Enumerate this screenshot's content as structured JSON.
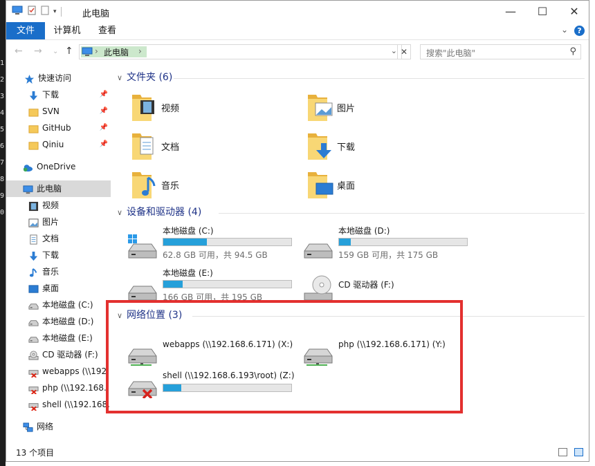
{
  "window": {
    "title": "此电脑",
    "min_glyph": "—",
    "max_glyph": "☐",
    "close_glyph": "✕"
  },
  "ribbon": {
    "tabs": [
      {
        "label": "文件"
      },
      {
        "label": "计算机"
      },
      {
        "label": "查看"
      }
    ],
    "help": "?"
  },
  "nav": {
    "back": "←",
    "forward": "→",
    "up": "↑",
    "breadcrumb": "此电脑",
    "crumb_arrow": "›",
    "dropdown": "⌄",
    "clear": "✕",
    "search_placeholder": "搜索\"此电脑\""
  },
  "background_line_numbers": [
    "1",
    "2",
    "3",
    "4",
    "5",
    "6",
    "7",
    "8",
    "9",
    "0"
  ],
  "sidebar": {
    "items": [
      {
        "label": "快速访问",
        "icon": "star-icon"
      },
      {
        "label": "下载",
        "icon": "download-icon",
        "pinned": true
      },
      {
        "label": "SVN",
        "icon": "folder-icon",
        "pinned": true
      },
      {
        "label": "GitHub",
        "icon": "folder-icon",
        "pinned": true
      },
      {
        "label": "Qiniu",
        "icon": "folder-icon",
        "pinned": true
      },
      {
        "label": "OneDrive",
        "icon": "cloud-icon"
      },
      {
        "label": "此电脑",
        "icon": "computer-icon"
      },
      {
        "label": "视频",
        "icon": "video-icon"
      },
      {
        "label": "图片",
        "icon": "picture-icon"
      },
      {
        "label": "文档",
        "icon": "document-icon"
      },
      {
        "label": "下载",
        "icon": "download-icon"
      },
      {
        "label": "音乐",
        "icon": "music-icon"
      },
      {
        "label": "桌面",
        "icon": "desktop-icon"
      },
      {
        "label": "本地磁盘 (C:)",
        "icon": "drive-icon"
      },
      {
        "label": "本地磁盘 (D:)",
        "icon": "drive-icon"
      },
      {
        "label": "本地磁盘 (E:)",
        "icon": "drive-icon"
      },
      {
        "label": "CD 驱动器 (F:)",
        "icon": "cd-icon"
      },
      {
        "label": "webapps (\\\\192",
        "icon": "network-drive-off-icon"
      },
      {
        "label": "php (\\\\192.168.",
        "icon": "network-drive-off-icon"
      },
      {
        "label": "shell (\\\\192.168.",
        "icon": "network-drive-off-icon"
      },
      {
        "label": "网络",
        "icon": "network-icon"
      }
    ]
  },
  "groups": {
    "folders": {
      "title": "文件夹 (6)"
    },
    "devices": {
      "title": "设备和驱动器 (4)"
    },
    "network": {
      "title": "网络位置 (3)"
    }
  },
  "folders": [
    {
      "label": "视频",
      "icon": "video-folder-icon"
    },
    {
      "label": "图片",
      "icon": "picture-folder-icon"
    },
    {
      "label": "文档",
      "icon": "document-folder-icon"
    },
    {
      "label": "下载",
      "icon": "download-folder-icon"
    },
    {
      "label": "音乐",
      "icon": "music-folder-icon"
    },
    {
      "label": "桌面",
      "icon": "desktop-folder-icon"
    }
  ],
  "drives": [
    {
      "name": "本地磁盘 (C:)",
      "free": "62.8 GB 可用，共 94.5 GB",
      "used_fraction": 0.34,
      "icon": "windows-drive-icon"
    },
    {
      "name": "本地磁盘 (D:)",
      "free": "159 GB 可用，共 175 GB",
      "used_fraction": 0.09,
      "icon": "drive-icon"
    },
    {
      "name": "本地磁盘 (E:)",
      "free": "166 GB 可用，共 195 GB",
      "used_fraction": 0.15,
      "icon": "drive-icon"
    },
    {
      "name": "CD 驱动器 (F:)",
      "icon": "cd-drive-icon"
    }
  ],
  "network_locations": [
    {
      "name": "webapps (\\\\192.168.6.171) (X:)",
      "icon": "network-drive-icon"
    },
    {
      "name": "php (\\\\192.168.6.171) (Y:)",
      "icon": "network-drive-icon"
    },
    {
      "name": "shell (\\\\192.168.6.193\\root) (Z:)",
      "used_fraction": 0.14,
      "icon": "network-drive-disconnected-icon"
    }
  ],
  "status": {
    "count": "13 个项目"
  },
  "colors": {
    "accent": "#1a6ec9",
    "highlight_box": "#e3302f",
    "bar_fill": "#26a0da",
    "group_title": "#1e3287"
  }
}
